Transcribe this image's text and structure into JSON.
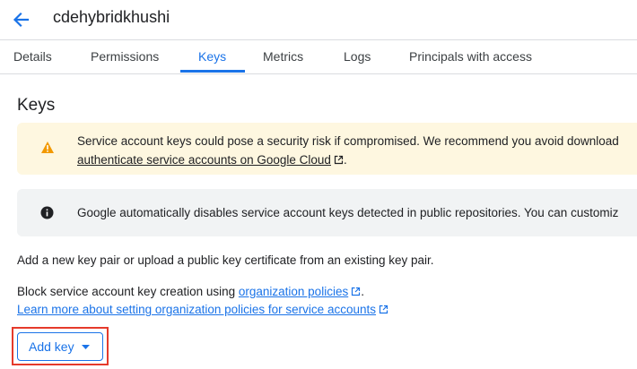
{
  "header": {
    "title": "cdehybridkhushi",
    "back_icon": "arrow-left-icon"
  },
  "tabs": [
    {
      "label": "Details",
      "active": false
    },
    {
      "label": "Permissions",
      "active": false
    },
    {
      "label": "Keys",
      "active": true
    },
    {
      "label": "Metrics",
      "active": false
    },
    {
      "label": "Logs",
      "active": false
    },
    {
      "label": "Principals with access",
      "active": false
    }
  ],
  "section": {
    "title": "Keys"
  },
  "warning_banner": {
    "icon": "warning-icon",
    "line1": "Service account keys could pose a security risk if compromised. We recommend you avoid download",
    "link": "authenticate service accounts on Google Cloud",
    "link_suffix": "."
  },
  "info_banner": {
    "icon": "info-icon",
    "text": "Google automatically disables service account keys detected in public repositories. You can customiz"
  },
  "description": "Add a new key pair or upload a public key certificate from an existing key pair.",
  "policy": {
    "prefix": "Block service account key creation using ",
    "link": "organization policies",
    "suffix": ".",
    "learn_more": "Learn more about setting organization policies for service accounts"
  },
  "add_key_button": {
    "label": "Add key"
  },
  "colors": {
    "accent": "#1a73e8",
    "warning_bg": "#fef7e0",
    "warning_icon": "#f29900",
    "info_bg": "#f1f3f4",
    "highlight": "#e53a2b"
  }
}
